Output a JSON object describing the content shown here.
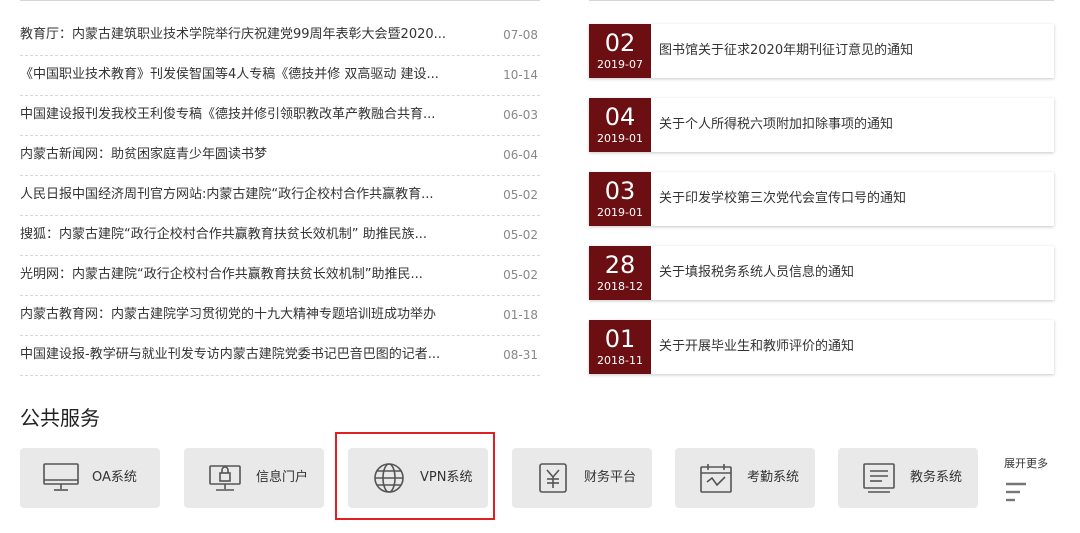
{
  "news": [
    {
      "title": "教育厅：内蒙古建筑职业技术学院举行庆祝建党99周年表彰大会暨2020...",
      "date": "07-08"
    },
    {
      "title": "《中国职业技术教育》刊发侯智国等4人专稿《德技并修 双高驱动 建设...",
      "date": "10-14"
    },
    {
      "title": "中国建设报刊发我校王利俊专稿《德技并修引领职教改革产教融合共育...",
      "date": "06-03"
    },
    {
      "title": "内蒙古新闻网：助贫困家庭青少年圆读书梦",
      "date": "06-04"
    },
    {
      "title": "人民日报中国经济周刊官方网站:内蒙古建院“政行企校村合作共赢教育...",
      "date": "05-02"
    },
    {
      "title": "搜狐：内蒙古建院“政行企校村合作共赢教育扶贫长效机制” 助推民族...",
      "date": "05-02"
    },
    {
      "title": "光明网：内蒙古建院“政行企校村合作共赢教育扶贫长效机制”助推民...",
      "date": "05-02"
    },
    {
      "title": "内蒙古教育网：内蒙古建院学习贯彻党的十九大精神专题培训班成功举办",
      "date": "01-18"
    },
    {
      "title": "中国建设报-教学研与就业刊发专访内蒙古建院党委书记巴音巴图的记者...",
      "date": "08-31"
    }
  ],
  "notices": [
    {
      "day": "02",
      "ym": "2019-07",
      "title": "图书馆关于征求2020年期刊征订意见的通知"
    },
    {
      "day": "04",
      "ym": "2019-01",
      "title": "关于个人所得税六项附加扣除事项的通知"
    },
    {
      "day": "03",
      "ym": "2019-01",
      "title": "关于印发学校第三次党代会宣传口号的通知"
    },
    {
      "day": "28",
      "ym": "2018-12",
      "title": "关于填报税务系统人员信息的通知"
    },
    {
      "day": "01",
      "ym": "2018-11",
      "title": "关于开展毕业生和教师评价的通知"
    }
  ],
  "services": {
    "title": "公共服务",
    "items": [
      {
        "label": "OA系统",
        "icon": "monitor-icon"
      },
      {
        "label": "信息门户",
        "icon": "lock-screen-icon"
      },
      {
        "label": "VPN系统",
        "icon": "globe-icon"
      },
      {
        "label": "财务平台",
        "icon": "yuan-icon"
      },
      {
        "label": "考勤系统",
        "icon": "calendar-check-icon"
      },
      {
        "label": "教务系统",
        "icon": "list-doc-icon"
      }
    ],
    "more_label": "展开更多"
  },
  "colors": {
    "accent": "#6b0f12",
    "highlight": "#e02020",
    "tile": "#e9e9e9"
  }
}
